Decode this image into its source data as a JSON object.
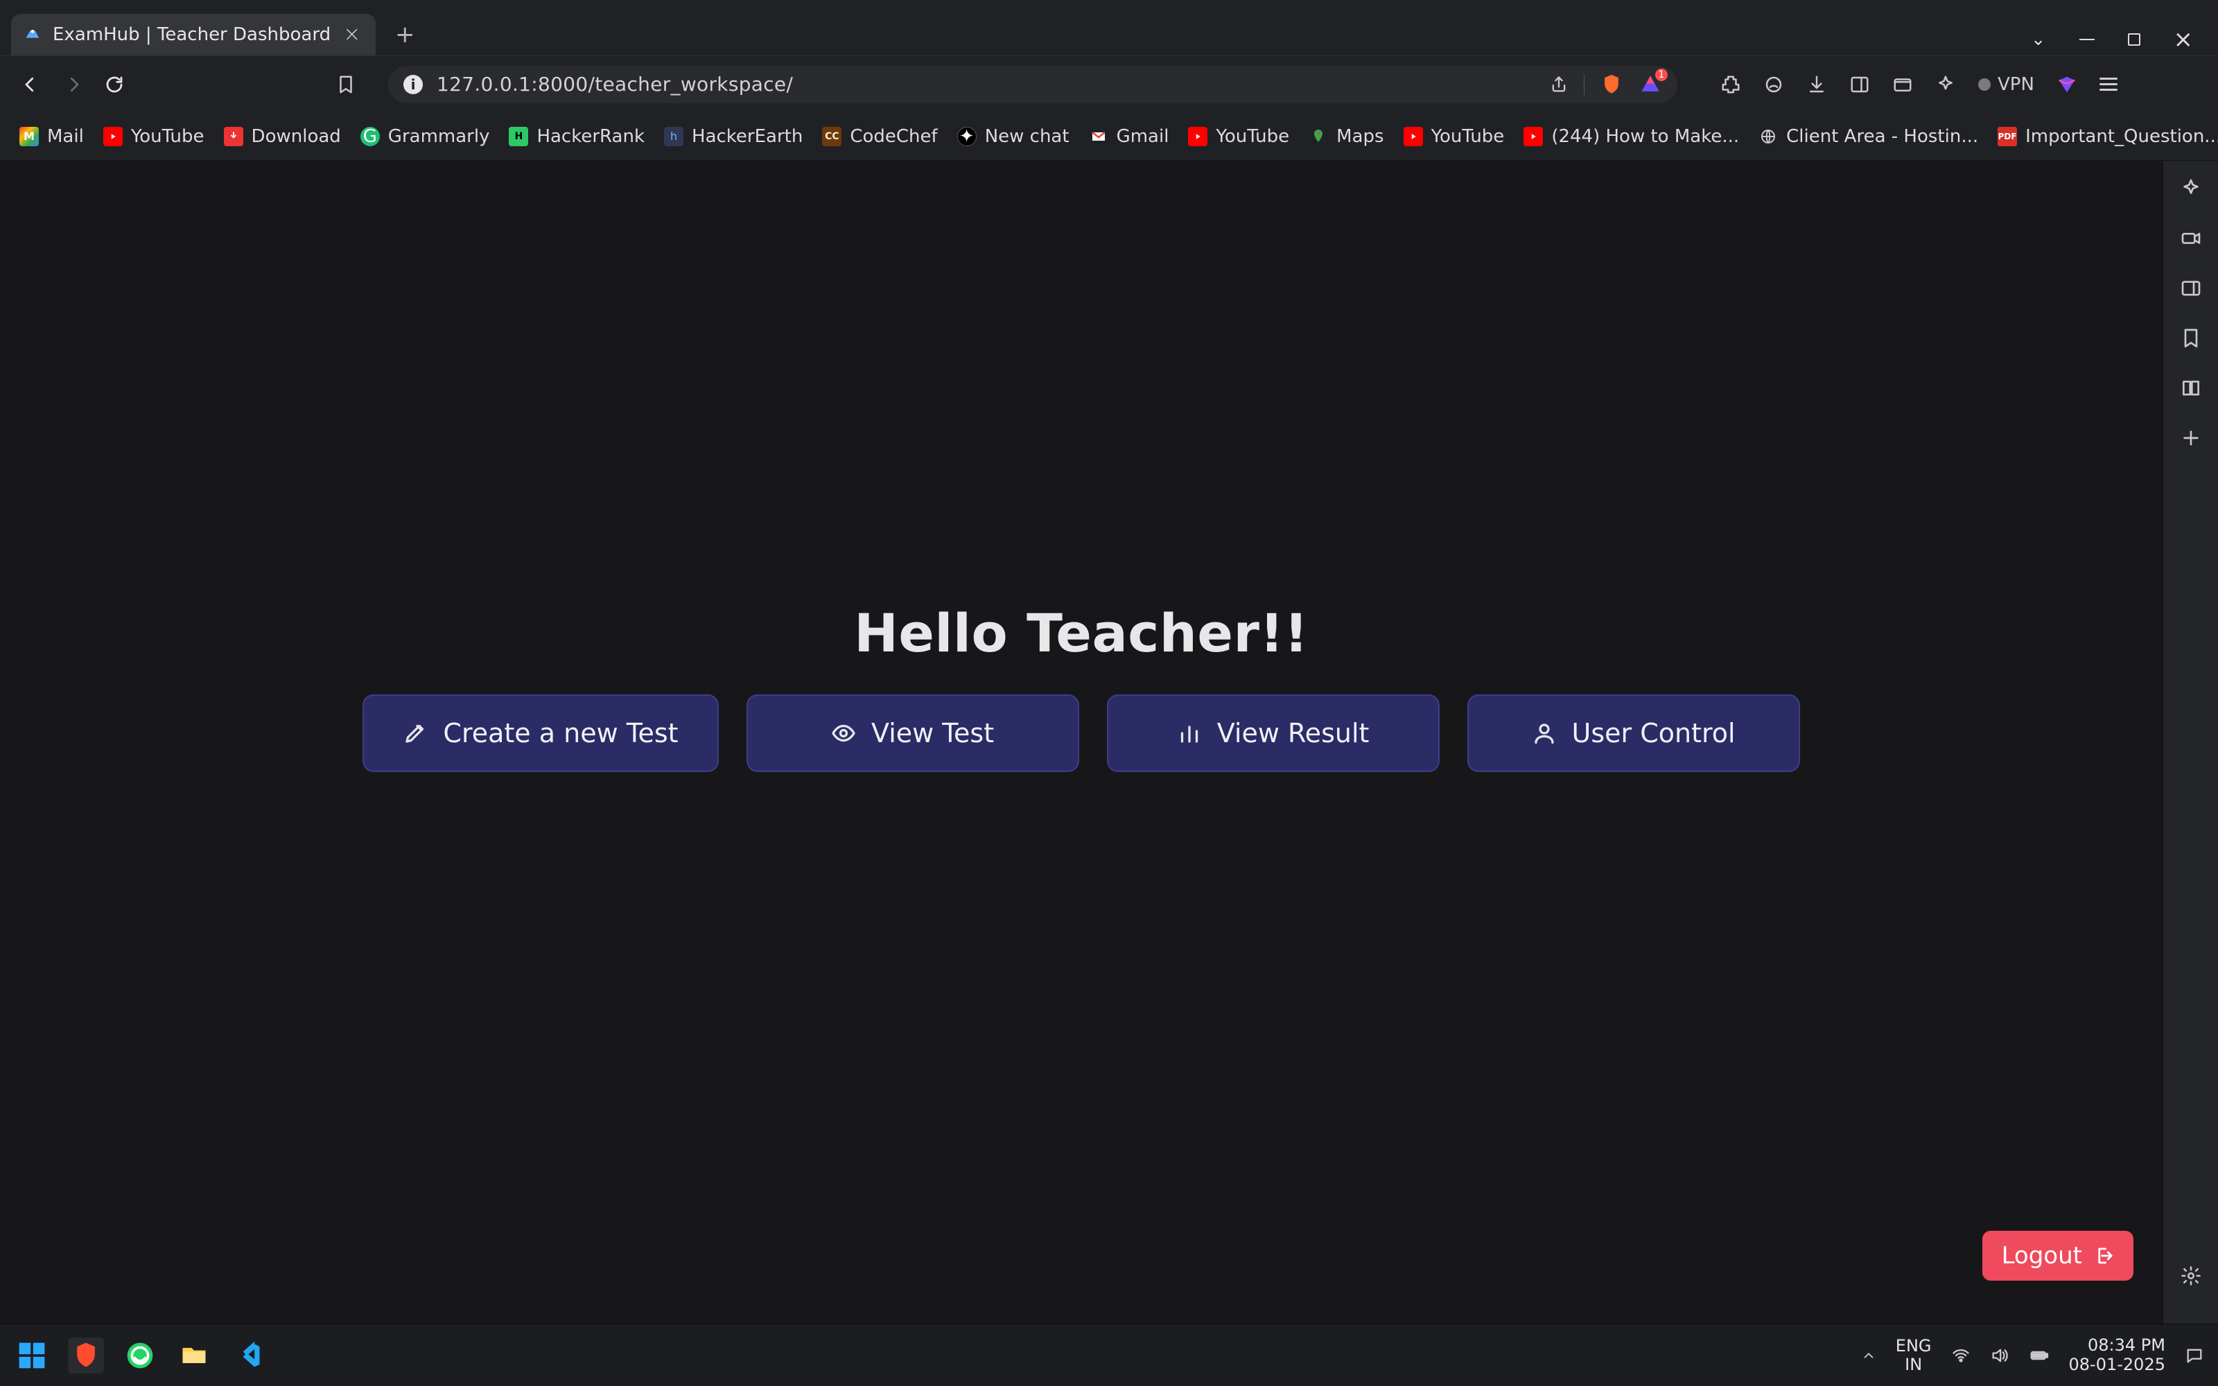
{
  "browser": {
    "tab": {
      "title": "ExamHub | Teacher Dashboard"
    },
    "url": "127.0.0.1:8000/teacher_workspace/",
    "vpn_label": "VPN",
    "rewards_badge": "1"
  },
  "bookmarks": [
    {
      "label": "Mail"
    },
    {
      "label": "YouTube"
    },
    {
      "label": "Download"
    },
    {
      "label": "Grammarly"
    },
    {
      "label": "HackerRank"
    },
    {
      "label": "HackerEarth"
    },
    {
      "label": "CodeChef"
    },
    {
      "label": "New chat"
    },
    {
      "label": "Gmail"
    },
    {
      "label": "YouTube"
    },
    {
      "label": "Maps"
    },
    {
      "label": "YouTube"
    },
    {
      "label": "(244) How to Make..."
    },
    {
      "label": "Client Area - Hostin..."
    },
    {
      "label": "Important_Question..."
    }
  ],
  "page": {
    "heading": "Hello Teacher!!",
    "buttons": {
      "create": "Create a new Test",
      "view_test": "View Test",
      "view_result": "View Result",
      "user_control": "User Control"
    },
    "logout": "Logout"
  },
  "system": {
    "lang_top": "ENG",
    "lang_bottom": "IN",
    "time": "08:34 PM",
    "date": "08-01-2025"
  }
}
